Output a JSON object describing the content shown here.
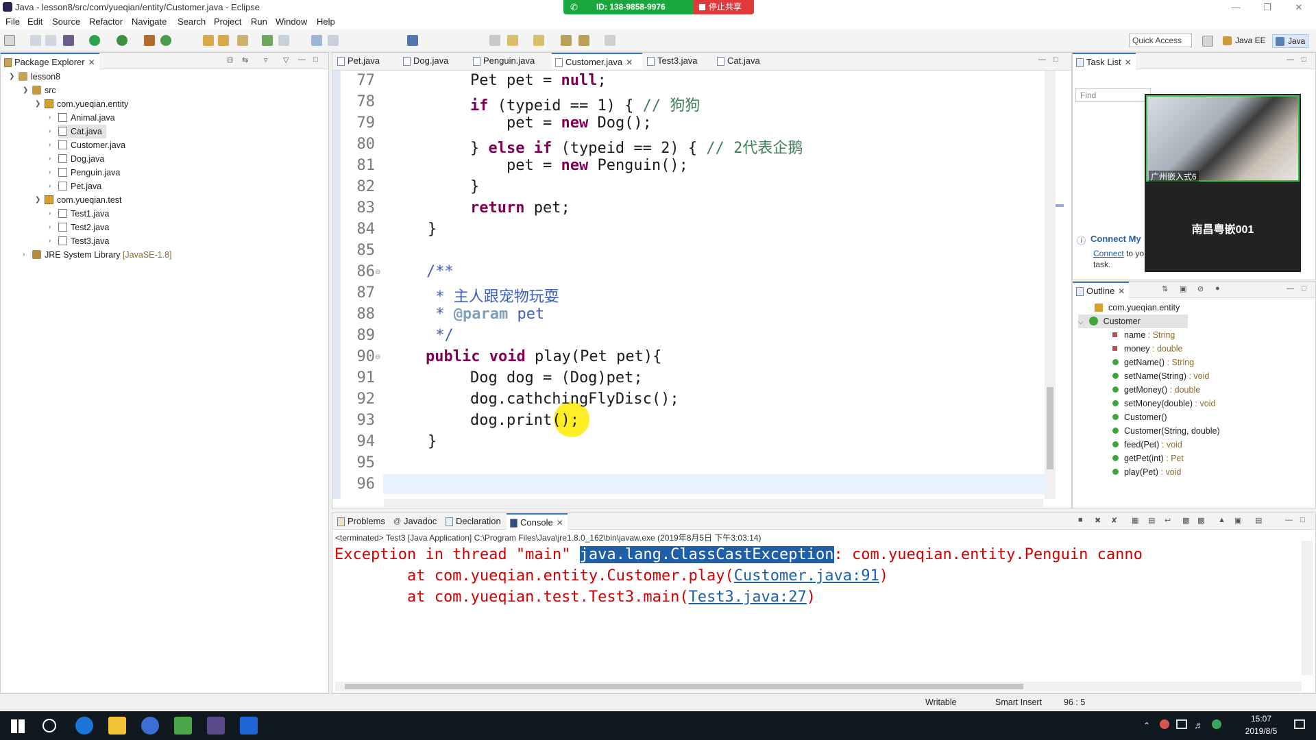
{
  "window": {
    "title": "Java - lesson8/src/com/yueqian/entity/Customer.java - Eclipse"
  },
  "share_bar": {
    "id_text": "ID: 138-9858-9976",
    "stop_label": "停止共享"
  },
  "menu": [
    "File",
    "Edit",
    "Source",
    "Refactor",
    "Navigate",
    "Search",
    "Project",
    "Run",
    "Window",
    "Help"
  ],
  "toolbar": {
    "quick_access": "Quick Access",
    "perspectives": [
      {
        "label": "Java EE",
        "active": false
      },
      {
        "label": "Java",
        "active": true
      }
    ]
  },
  "package_explorer": {
    "title": "Package Explorer",
    "tree": [
      {
        "label": "lesson8",
        "icon": "project-icon",
        "level": 0,
        "expanded": true
      },
      {
        "label": "src",
        "icon": "source-folder-icon",
        "level": 1,
        "expanded": true
      },
      {
        "label": "com.yueqian.entity",
        "icon": "package-icon",
        "level": 2,
        "expanded": true
      },
      {
        "label": "Animal.java",
        "icon": "java-file-icon",
        "level": 3
      },
      {
        "label": "Cat.java",
        "icon": "java-file-icon",
        "level": 3,
        "selected": true
      },
      {
        "label": "Customer.java",
        "icon": "java-file-icon",
        "level": 3
      },
      {
        "label": "Dog.java",
        "icon": "java-file-icon",
        "level": 3
      },
      {
        "label": "Penguin.java",
        "icon": "java-file-icon",
        "level": 3
      },
      {
        "label": "Pet.java",
        "icon": "java-file-icon",
        "level": 3
      },
      {
        "label": "com.yueqian.test",
        "icon": "package-icon",
        "level": 2,
        "expanded": true
      },
      {
        "label": "Test1.java",
        "icon": "java-file-icon",
        "level": 3
      },
      {
        "label": "Test2.java",
        "icon": "java-file-icon",
        "level": 3
      },
      {
        "label": "Test3.java",
        "icon": "java-file-icon",
        "level": 3
      },
      {
        "label": "JRE System Library",
        "suffix": "[JavaSE-1.8]",
        "icon": "library-icon",
        "level": 1
      }
    ]
  },
  "editor": {
    "tabs": [
      {
        "label": "Pet.java",
        "active": false
      },
      {
        "label": "Dog.java",
        "active": false
      },
      {
        "label": "Penguin.java",
        "active": false
      },
      {
        "label": "Customer.java",
        "active": true
      },
      {
        "label": "Test3.java",
        "active": false
      },
      {
        "label": "Cat.java",
        "active": false
      }
    ],
    "line_numbers": [
      "77",
      "78",
      "79",
      "80",
      "81",
      "82",
      "83",
      "84",
      "85",
      "86",
      "87",
      "88",
      "89",
      "90",
      "91",
      "92",
      "93",
      "94",
      "95",
      "96"
    ],
    "code": {
      "l77_a": "Pet pet = ",
      "l77_b": "null",
      "l77_c": ";",
      "l78_a": "if",
      "l78_b": " (typeid == 1) { ",
      "l78_c": "// 狗狗",
      "l79_a": "    pet = ",
      "l79_b": "new",
      "l79_c": " Dog();",
      "l80_a": "} ",
      "l80_b": "else if",
      "l80_c": " (typeid == 2) { ",
      "l80_d": "// 2代表企鹅",
      "l81_a": "    pet = ",
      "l81_b": "new",
      "l81_c": " Penguin();",
      "l82": "}",
      "l83_a": "return",
      "l83_b": " pet;",
      "l84": "}",
      "l86": "/**",
      "l87": " * 主人跟宠物玩耍",
      "l88_a": " * ",
      "l88_b": "@param",
      "l88_c": " pet",
      "l89": " */",
      "l90_a": "public void",
      "l90_b": " play(Pet pet){",
      "l91": "Dog dog = (Dog)pet;",
      "l92": "dog.cathchingFlyDisc();",
      "l93": "dog.print();",
      "l94": "}"
    }
  },
  "task_list": {
    "title": "Task List",
    "find_placeholder": "Find",
    "connect_title": "Connect My",
    "connect_link": "Connect",
    "connect_text": " to yo",
    "connect_text2": "task."
  },
  "video": {
    "cam_label": "广州嵌入式6",
    "name": "南昌粤嵌001"
  },
  "outline": {
    "title": "Outline",
    "package": "com.yueqian.entity",
    "class": "Customer",
    "members": [
      {
        "name": "name",
        "type": " : String",
        "kind": "field"
      },
      {
        "name": "money",
        "type": " : double",
        "kind": "field"
      },
      {
        "name": "getName()",
        "type": " : String",
        "kind": "method"
      },
      {
        "name": "setName(String)",
        "type": " : void",
        "kind": "method"
      },
      {
        "name": "getMoney()",
        "type": " : double",
        "kind": "method"
      },
      {
        "name": "setMoney(double)",
        "type": " : void",
        "kind": "method"
      },
      {
        "name": "Customer()",
        "type": "",
        "kind": "constructor"
      },
      {
        "name": "Customer(String, double)",
        "type": "",
        "kind": "constructor"
      },
      {
        "name": "feed(Pet)",
        "type": " : void",
        "kind": "method"
      },
      {
        "name": "getPet(int)",
        "type": " : Pet",
        "kind": "method"
      },
      {
        "name": "play(Pet)",
        "type": " : void",
        "kind": "method"
      }
    ]
  },
  "console": {
    "tabs": [
      {
        "label": "Problems",
        "active": false
      },
      {
        "label": "Javadoc",
        "active": false
      },
      {
        "label": "Declaration",
        "active": false
      },
      {
        "label": "Console",
        "active": true
      }
    ],
    "terminated": "<terminated> Test3 [Java Application] C:\\Program Files\\Java\\jre1.8.0_162\\bin\\javaw.exe (2019年8月5日 下午3:03:14)",
    "line1_a": "Exception in thread \"main\" ",
    "line1_b": "java.lang.ClassCastException",
    "line1_c": ": com.yueqian.entity.Penguin canno",
    "line2_a": "        at com.yueqian.entity.Customer.play(",
    "line2_b": "Customer.java:91",
    "line2_c": ")",
    "line3_a": "        at com.yueqian.test.Test3.main(",
    "line3_b": "Test3.java:27",
    "line3_c": ")"
  },
  "status": {
    "writable": "Writable",
    "insert_mode": "Smart Insert",
    "position": "96 : 5"
  },
  "taskbar": {
    "time": "15:07",
    "date": "2019/8/5"
  }
}
